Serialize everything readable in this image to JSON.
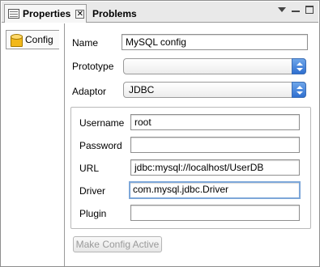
{
  "tabs": [
    {
      "label": "Properties",
      "active": true
    },
    {
      "label": "Problems",
      "active": false
    }
  ],
  "sidebar": {
    "items": [
      {
        "label": "Config",
        "icon": "database-icon"
      }
    ]
  },
  "form": {
    "name": {
      "label": "Name",
      "value": "MySQL config"
    },
    "prototype": {
      "label": "Prototype",
      "value": ""
    },
    "adaptor": {
      "label": "Adaptor",
      "value": "JDBC"
    },
    "username": {
      "label": "Username",
      "value": "root"
    },
    "password": {
      "label": "Password",
      "value": ""
    },
    "url": {
      "label": "URL",
      "value": "jdbc:mysql://localhost/UserDB"
    },
    "driver": {
      "label": "Driver",
      "value": "com.mysql.jdbc.Driver"
    },
    "plugin": {
      "label": "Plugin",
      "value": ""
    },
    "activate_button": {
      "label": "Make Config Active",
      "enabled": false
    }
  },
  "colors": {
    "focus_ring": "#7da7d9",
    "select_accent": "#3a78d8",
    "tab_bg": "#e9e9e9"
  }
}
